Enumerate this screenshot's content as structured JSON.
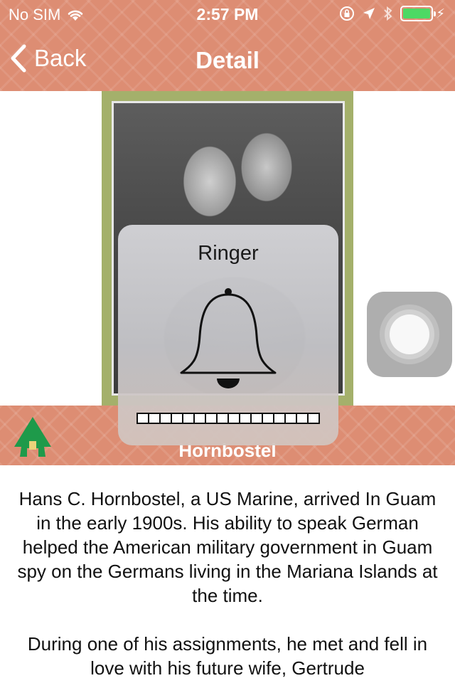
{
  "status_bar": {
    "carrier": "No SIM",
    "time": "2:57 PM",
    "icons": [
      "wifi-icon",
      "orientation-lock-icon",
      "location-arrow-icon",
      "bluetooth-icon",
      "battery-icon",
      "charging-bolt-icon"
    ],
    "battery_level": 1.0,
    "battery_color": "#4cd964"
  },
  "nav": {
    "back_label": "Back",
    "title": "Detail"
  },
  "caption": {
    "title": "Hornbostel",
    "logo": "hut-logo"
  },
  "body": {
    "paragraphs": [
      "Hans C. Hornbostel, a US Marine, arrived In Guam in the early 1900s. His ability to speak German helped the American military government in Guam spy on the Germans living in the Mariana Islands at the time.",
      "During one of his assignments, he met and fell in love with his future wife, Gertrude"
    ]
  },
  "ringer_hud": {
    "title": "Ringer",
    "icon": "bell-icon",
    "volume_level": 0,
    "volume_segments": 16
  },
  "colors": {
    "header": "#dd8d73",
    "photo_frame": "#a4b06b",
    "logo_green": "#1e9a4a"
  }
}
